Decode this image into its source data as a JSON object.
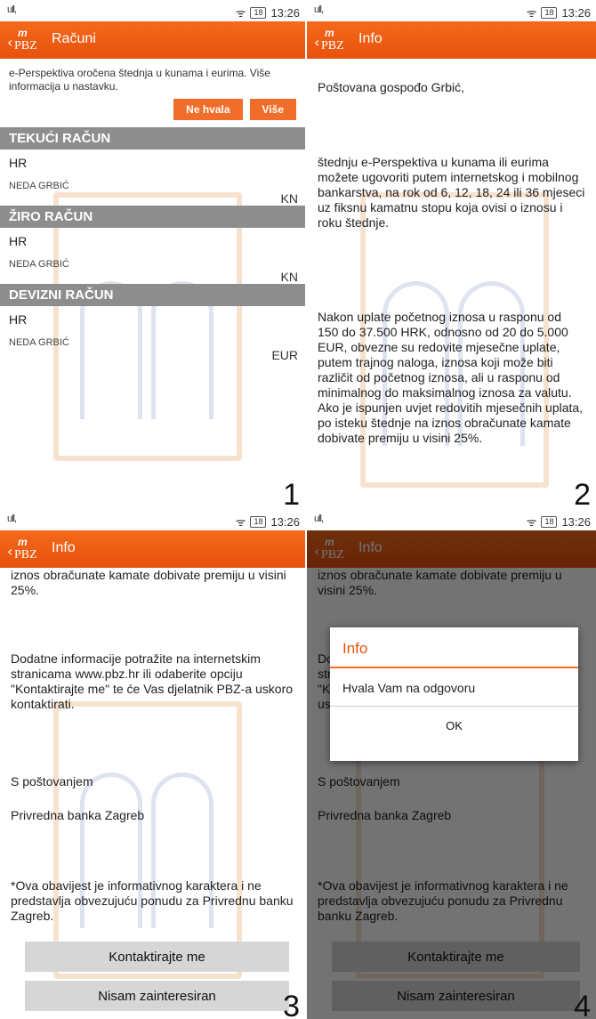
{
  "status": {
    "signal": "ull,",
    "signal_icon": "signal-icon",
    "wifi": "ᯤ",
    "battery": "18",
    "time": "13:26"
  },
  "p1": {
    "title": "Računi",
    "promo_text": "e-Perspektiva oročena štednja u kunama i eurima. Više informacija u nastavku.",
    "btn_no": "Ne hvala",
    "btn_more": "Više",
    "accounts": [
      {
        "header": "TEKUĆI RAČUN",
        "iban": "HR",
        "owner": "NEDA GRBIĆ",
        "currency": "KN"
      },
      {
        "header": "ŽIRO RAČUN",
        "iban": "HR",
        "owner": "NEDA GRBIĆ",
        "currency": "KN"
      },
      {
        "header": "DEVIZNI RAČUN",
        "iban": "HR",
        "owner": "NEDA GRBIĆ",
        "currency": "EUR"
      }
    ],
    "number": "1"
  },
  "p2": {
    "title": "Info",
    "greeting": "Poštovana gospođo Grbić,",
    "para1": "štednju e-Perspektiva u kunama ili eurima možete ugovoriti putem internetskog i mobilnog bankarstva, na rok od 6, 12, 18, 24 ili 36 mjeseci uz fiksnu kamatnu stopu koja ovisi o iznosu i roku štednje.",
    "para2": "Nakon uplate početnog iznosa u rasponu od 150 do 37.500 HRK, odnosno od 20 do 5.000 EUR, obvezne su redovite mjesečne uplate, putem trajnog naloga, iznosa koji može biti različit od početnog iznosa, ali u rasponu od minimalnog do maksimalnog iznosa za valutu. Ako je ispunjen uvjet redovitih mjesečnih uplata, po isteku štednje na iznos obračunate kamate dobivate premiju u visini 25%.",
    "number": "2"
  },
  "p3": {
    "title": "Info",
    "para_top": "iznos obračunate kamate dobivate premiju u visini 25%.",
    "para_info": "Dodatne informacije potražite na internetskim stranicama www.pbz.hr ili odaberite opciju \"Kontaktirajte me\" te će Vas djelatnik PBZ-a uskoro kontaktirati.",
    "regards": "S poštovanjem",
    "bank": "Privredna banka Zagreb",
    "disclaimer": "*Ova obavijest je informativnog karaktera i ne predstavlja obvezujuću ponudu za Privrednu banku Zagreb.",
    "btn_contact": "Kontaktirajte me",
    "btn_not": "Nisam zainteresiran",
    "number": "3"
  },
  "p4": {
    "dialog_title": "Info",
    "dialog_message": "Hvala Vam na odgovoru",
    "dialog_ok": "OK",
    "number": "4"
  },
  "logo": {
    "m": "m",
    "pbz": "PBZ",
    "chev": "‹"
  },
  "colors": {
    "orange": "#ee5d14",
    "header_gray": "#8d8d8d",
    "button_gray": "#d6d6d6"
  }
}
